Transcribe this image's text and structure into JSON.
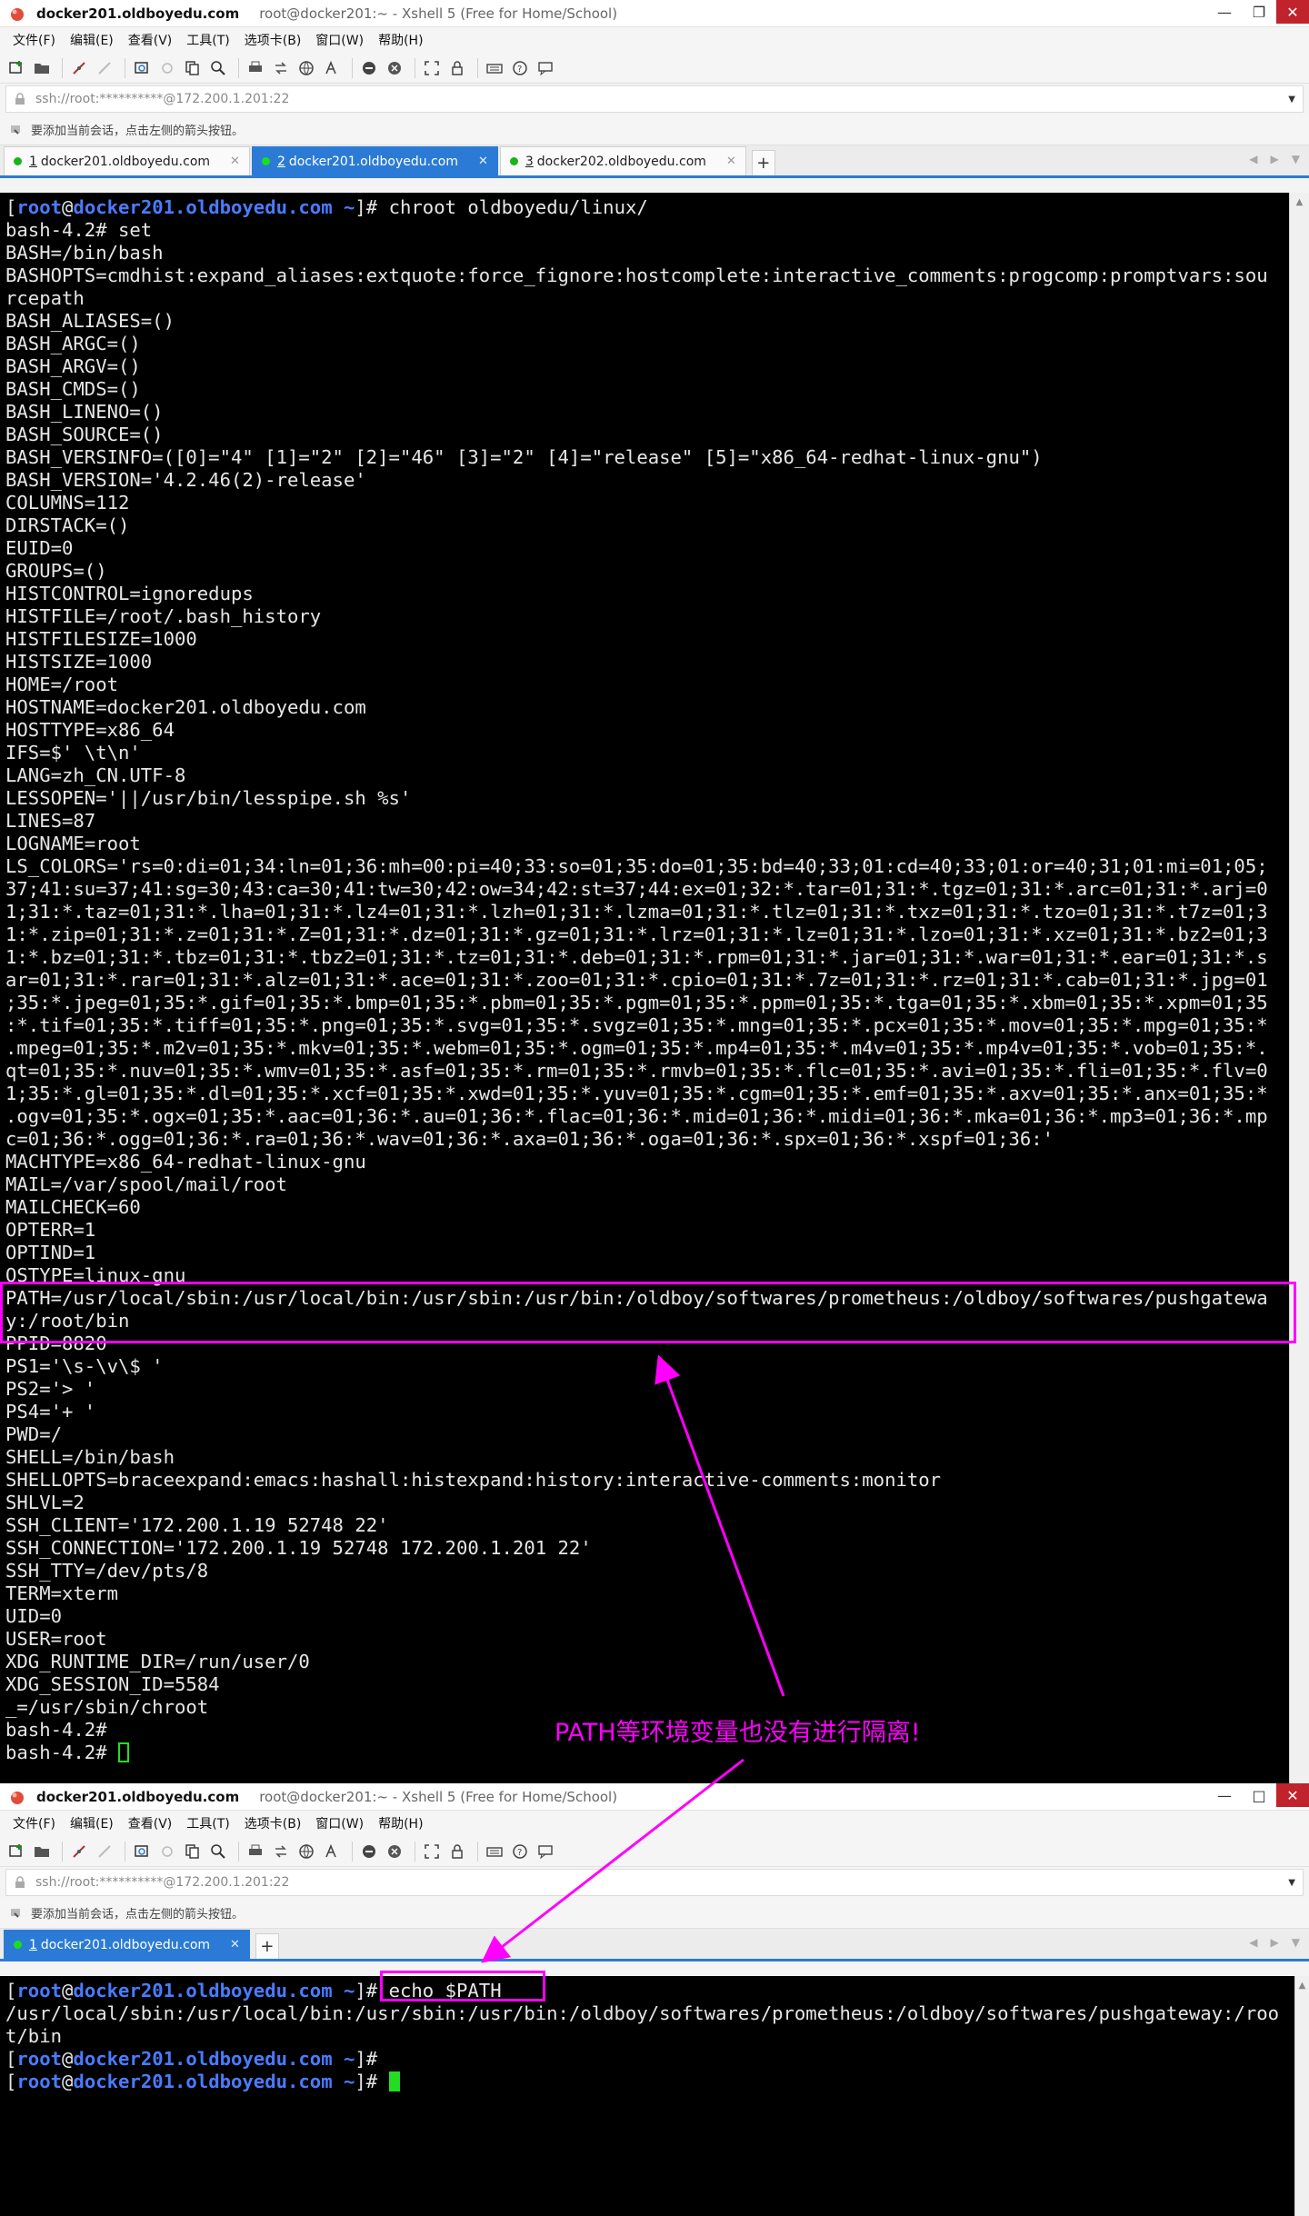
{
  "windows": [
    {
      "title_host": "docker201.oldboyedu.com",
      "title_rest": "root@docker201:~ - Xshell 5 (Free for Home/School)",
      "menu": [
        "文件(F)",
        "编辑(E)",
        "查看(V)",
        "工具(T)",
        "选项卡(B)",
        "窗口(W)",
        "帮助(H)"
      ],
      "address": "ssh://root:**********@172.200.1.201:22",
      "hint": "要添加当前会话，点击左侧的箭头按钮。",
      "tabs": [
        {
          "num": "1",
          "label": "docker201.oldboyedu.com",
          "active": false
        },
        {
          "num": "2",
          "label": "docker201.oldboyedu.com",
          "active": true
        },
        {
          "num": "3",
          "label": "docker202.oldboyedu.com",
          "active": false
        }
      ],
      "terminal": {
        "prompt_user": "root",
        "prompt_host": "docker201.oldboyedu.com",
        "command": "chroot oldboyedu/linux/",
        "lines": [
          "bash-4.2# set",
          "BASH=/bin/bash",
          "BASHOPTS=cmdhist:expand_aliases:extquote:force_fignore:hostcomplete:interactive_comments:progcomp:promptvars:sou",
          "rcepath",
          "BASH_ALIASES=()",
          "BASH_ARGC=()",
          "BASH_ARGV=()",
          "BASH_CMDS=()",
          "BASH_LINENO=()",
          "BASH_SOURCE=()",
          "BASH_VERSINFO=([0]=\"4\" [1]=\"2\" [2]=\"46\" [3]=\"2\" [4]=\"release\" [5]=\"x86_64-redhat-linux-gnu\")",
          "BASH_VERSION='4.2.46(2)-release'",
          "COLUMNS=112",
          "DIRSTACK=()",
          "EUID=0",
          "GROUPS=()",
          "HISTCONTROL=ignoredups",
          "HISTFILE=/root/.bash_history",
          "HISTFILESIZE=1000",
          "HISTSIZE=1000",
          "HOME=/root",
          "HOSTNAME=docker201.oldboyedu.com",
          "HOSTTYPE=x86_64",
          "IFS=$' \\t\\n'",
          "LANG=zh_CN.UTF-8",
          "LESSOPEN='||/usr/bin/lesspipe.sh %s'",
          "LINES=87",
          "LOGNAME=root",
          "LS_COLORS='rs=0:di=01;34:ln=01;36:mh=00:pi=40;33:so=01;35:do=01;35:bd=40;33;01:cd=40;33;01:or=40;31;01:mi=01;05;",
          "37;41:su=37;41:sg=30;43:ca=30;41:tw=30;42:ow=34;42:st=37;44:ex=01;32:*.tar=01;31:*.tgz=01;31:*.arc=01;31:*.arj=0",
          "1;31:*.taz=01;31:*.lha=01;31:*.lz4=01;31:*.lzh=01;31:*.lzma=01;31:*.tlz=01;31:*.txz=01;31:*.tzo=01;31:*.t7z=01;3",
          "1:*.zip=01;31:*.z=01;31:*.Z=01;31:*.dz=01;31:*.gz=01;31:*.lrz=01;31:*.lz=01;31:*.lzo=01;31:*.xz=01;31:*.bz2=01;3",
          "1:*.bz=01;31:*.tbz=01;31:*.tbz2=01;31:*.tz=01;31:*.deb=01;31:*.rpm=01;31:*.jar=01;31:*.war=01;31:*.ear=01;31:*.s",
          "ar=01;31:*.rar=01;31:*.alz=01;31:*.ace=01;31:*.zoo=01;31:*.cpio=01;31:*.7z=01;31:*.rz=01;31:*.cab=01;31:*.jpg=01",
          ";35:*.jpeg=01;35:*.gif=01;35:*.bmp=01;35:*.pbm=01;35:*.pgm=01;35:*.ppm=01;35:*.tga=01;35:*.xbm=01;35:*.xpm=01;35",
          ":*.tif=01;35:*.tiff=01;35:*.png=01;35:*.svg=01;35:*.svgz=01;35:*.mng=01;35:*.pcx=01;35:*.mov=01;35:*.mpg=01;35:*",
          ".mpeg=01;35:*.m2v=01;35:*.mkv=01;35:*.webm=01;35:*.ogm=01;35:*.mp4=01;35:*.m4v=01;35:*.mp4v=01;35:*.vob=01;35:*.",
          "qt=01;35:*.nuv=01;35:*.wmv=01;35:*.asf=01;35:*.rm=01;35:*.rmvb=01;35:*.flc=01;35:*.avi=01;35:*.fli=01;35:*.flv=0",
          "1;35:*.gl=01;35:*.dl=01;35:*.xcf=01;35:*.xwd=01;35:*.yuv=01;35:*.cgm=01;35:*.emf=01;35:*.axv=01;35:*.anx=01;35:*",
          ".ogv=01;35:*.ogx=01;35:*.aac=01;36:*.au=01;36:*.flac=01;36:*.mid=01;36:*.midi=01;36:*.mka=01;36:*.mp3=01;36:*.mp",
          "c=01;36:*.ogg=01;36:*.ra=01;36:*.wav=01;36:*.axa=01;36:*.oga=01;36:*.spx=01;36:*.xspf=01;36:'",
          "MACHTYPE=x86_64-redhat-linux-gnu",
          "MAIL=/var/spool/mail/root",
          "MAILCHECK=60",
          "OPTERR=1",
          "OPTIND=1",
          "OSTYPE=linux-gnu",
          "PATH=/usr/local/sbin:/usr/local/bin:/usr/sbin:/usr/bin:/oldboy/softwares/prometheus:/oldboy/softwares/pushgatewa",
          "y:/root/bin",
          "PPID=8820",
          "PS1='\\s-\\v\\$ '",
          "PS2='> '",
          "PS4='+ '",
          "PWD=/",
          "SHELL=/bin/bash",
          "SHELLOPTS=braceexpand:emacs:hashall:histexpand:history:interactive-comments:monitor",
          "SHLVL=2",
          "SSH_CLIENT='172.200.1.19 52748 22'",
          "SSH_CONNECTION='172.200.1.19 52748 172.200.1.201 22'",
          "SSH_TTY=/dev/pts/8",
          "TERM=xterm",
          "UID=0",
          "USER=root",
          "XDG_RUNTIME_DIR=/run/user/0",
          "XDG_SESSION_ID=5584",
          "_=/usr/sbin/chroot",
          "bash-4.2#",
          "bash-4.2# "
        ]
      }
    },
    {
      "title_host": "docker201.oldboyedu.com",
      "title_rest": "root@docker201:~ - Xshell 5 (Free for Home/School)",
      "menu": [
        "文件(F)",
        "编辑(E)",
        "查看(V)",
        "工具(T)",
        "选项卡(B)",
        "窗口(W)",
        "帮助(H)"
      ],
      "address": "ssh://root:**********@172.200.1.201:22",
      "hint": "要添加当前会话，点击左侧的箭头按钮。",
      "tabs": [
        {
          "num": "1",
          "label": "docker201.oldboyedu.com",
          "active": true
        }
      ],
      "terminal": {
        "prompt_user": "root",
        "prompt_host": "docker201.oldboyedu.com",
        "command": "echo $PATH",
        "output": [
          "/usr/local/sbin:/usr/local/bin:/usr/sbin:/usr/bin:/oldboy/softwares/prometheus:/oldboy/softwares/pushgateway:/roo",
          "t/bin"
        ]
      }
    }
  ],
  "annotation": {
    "text": "PATH等环境变量也没有进行隔离!",
    "color": "#ff00ff"
  },
  "colors": {
    "prompt_blue": "#4a7bff",
    "cursor_green": "#22dd22",
    "tab_active": "#2b7bd6",
    "close_red": "#c0232b"
  }
}
